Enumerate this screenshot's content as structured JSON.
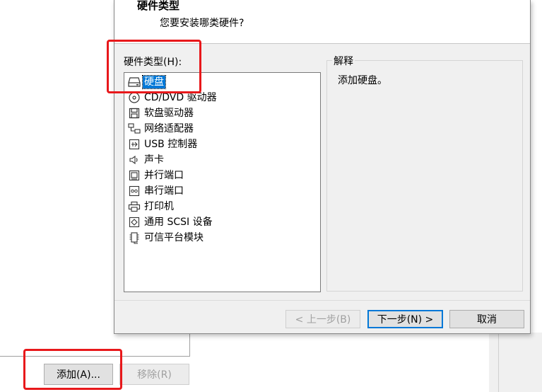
{
  "dialog": {
    "title": "硬件类型",
    "subtitle": "您要安装哪类硬件?",
    "list_label": "硬件类型(H):",
    "hardware_items": [
      {
        "label": "硬盘",
        "icon": "hard-disk-icon",
        "selected": true
      },
      {
        "label": "CD/DVD 驱动器",
        "icon": "cd-dvd-icon",
        "selected": false
      },
      {
        "label": "软盘驱动器",
        "icon": "floppy-icon",
        "selected": false
      },
      {
        "label": "网络适配器",
        "icon": "network-adapter-icon",
        "selected": false
      },
      {
        "label": "USB 控制器",
        "icon": "usb-icon",
        "selected": false
      },
      {
        "label": "声卡",
        "icon": "sound-icon",
        "selected": false
      },
      {
        "label": "并行端口",
        "icon": "parallel-port-icon",
        "selected": false
      },
      {
        "label": "串行端口",
        "icon": "serial-port-icon",
        "selected": false
      },
      {
        "label": "打印机",
        "icon": "printer-icon",
        "selected": false
      },
      {
        "label": "通用 SCSI 设备",
        "icon": "scsi-icon",
        "selected": false
      },
      {
        "label": "可信平台模块",
        "icon": "tpm-icon",
        "selected": false
      }
    ],
    "explanation_title": "解释",
    "explanation_text": "添加硬盘。",
    "buttons": {
      "back": "< 上一步(B)",
      "next": "下一步(N) >",
      "cancel": "取消"
    }
  },
  "parent": {
    "add_button": "添加(A)...",
    "remove_button": "移除(R)"
  },
  "colors": {
    "selection": "#0078d7",
    "highlight_box": "#e8181b"
  }
}
